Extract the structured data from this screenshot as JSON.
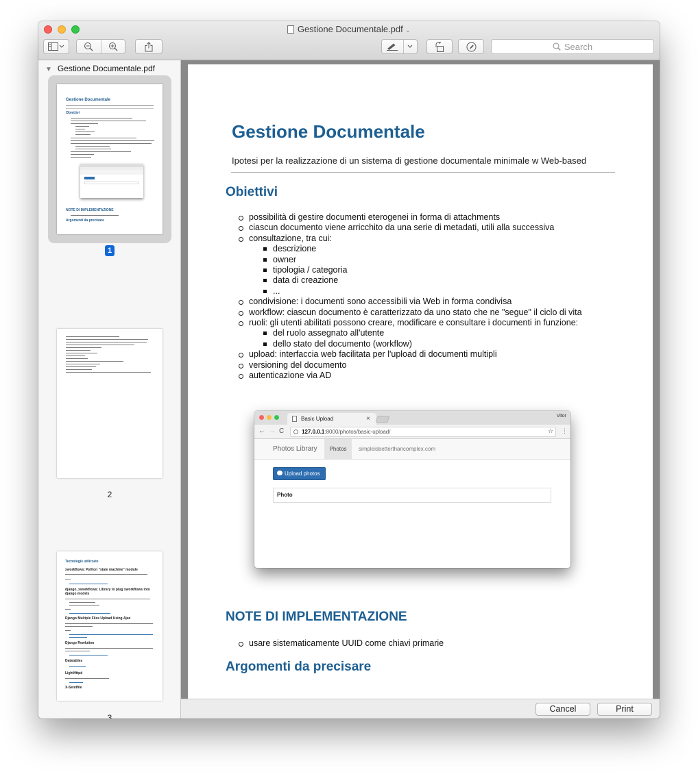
{
  "window": {
    "title": "Gestione Documentale.pdf",
    "title_chevron": "⌄"
  },
  "toolbar": {
    "search_placeholder": "Search",
    "sidebar_toggle_icon": "sidebar-icon",
    "zoom_out_icon": "zoom-out-icon",
    "zoom_in_icon": "zoom-in-icon",
    "share_icon": "share-icon",
    "markup_icon": "pen-icon",
    "rotate_icon": "rotate-icon",
    "annotate_icon": "markup-circle-icon"
  },
  "sidebar": {
    "document_label": "Gestione Documentale.pdf",
    "pages": [
      {
        "label": "1"
      },
      {
        "label": "2"
      },
      {
        "label": "3"
      }
    ],
    "thumb1": {
      "title": "Gestione Documentale",
      "section1": "Obiettivi",
      "section2": "NOTE DI IMPLEMENTAZIONE",
      "section3": "Argomenti da precisare"
    },
    "thumb3": {
      "h1": "Tecnologie utilizzate",
      "h2": "xworkflows: Python \"state machine\" module",
      "h3": "django_xworkflows: Library to plug xworkflows into django models",
      "h4": "Django Multiple Files Upload Using Ajax",
      "h5": "Django Rewlution",
      "h6": "Datatables",
      "h7": "LightHttpd",
      "h8": "X-Sendfile"
    }
  },
  "document": {
    "title": "Gestione Documentale",
    "subtitle": "Ipotesi per la realizzazione di un sistema di gestione documentale minimale w Web-based",
    "section_obiettivi": "Obiettivi",
    "items": [
      {
        "level": 1,
        "text": "possibilità di gestire documenti eterogenei in forma di attachments"
      },
      {
        "level": 1,
        "text": "ciascun documento viene arricchito da una serie di metadati, utili alla successiva"
      },
      {
        "level": 1,
        "text": "consultazione, tra cui:",
        "continuation": true
      },
      {
        "level": 2,
        "text": "descrizione"
      },
      {
        "level": 2,
        "text": "owner"
      },
      {
        "level": 2,
        "text": "tipologia / categoria"
      },
      {
        "level": 2,
        "text": "data di creazione"
      },
      {
        "level": 2,
        "text": "..."
      },
      {
        "level": 1,
        "text": "condivisione: i documenti sono accessibili via Web in forma condivisa"
      },
      {
        "level": 1,
        "text": "workflow: ciascun documento è caratterizzato da uno stato che ne \"segue\" il ciclo di vita"
      },
      {
        "level": 1,
        "text": "ruoli: gli utenti abilitati possono creare, modificare e consultare i documenti in funzione:"
      },
      {
        "level": 2,
        "text": "del ruolo assegnato all'utente"
      },
      {
        "level": 2,
        "text": "dello stato del documento (workflow)"
      },
      {
        "level": 1,
        "text": "upload: interfaccia web facilitata per l'upload di documenti multipli"
      },
      {
        "level": 1,
        "text": "versioning del documento"
      },
      {
        "level": 1,
        "text": "autenticazione via AD"
      }
    ],
    "screenshot": {
      "tab_title": "Basic Upload",
      "tab_close": "×",
      "profile_name": "Vitor",
      "url_host": "127.0.0.1",
      "url_path": ":8000/photos/basic-upload/",
      "brand": "Photos Library",
      "nav_active": "Photos",
      "nav_link": "simpleisbetterthancomplex.com",
      "upload_button": "Upload photos",
      "table_header": "Photo"
    },
    "section_note": "NOTE DI IMPLEMENTAZIONE",
    "note_items": [
      {
        "text": "usare sistematicamente UUID come chiavi primarie"
      }
    ],
    "section_argomenti": "Argomenti da precisare"
  },
  "footer": {
    "cancel_label": "Cancel",
    "print_label": "Print"
  }
}
